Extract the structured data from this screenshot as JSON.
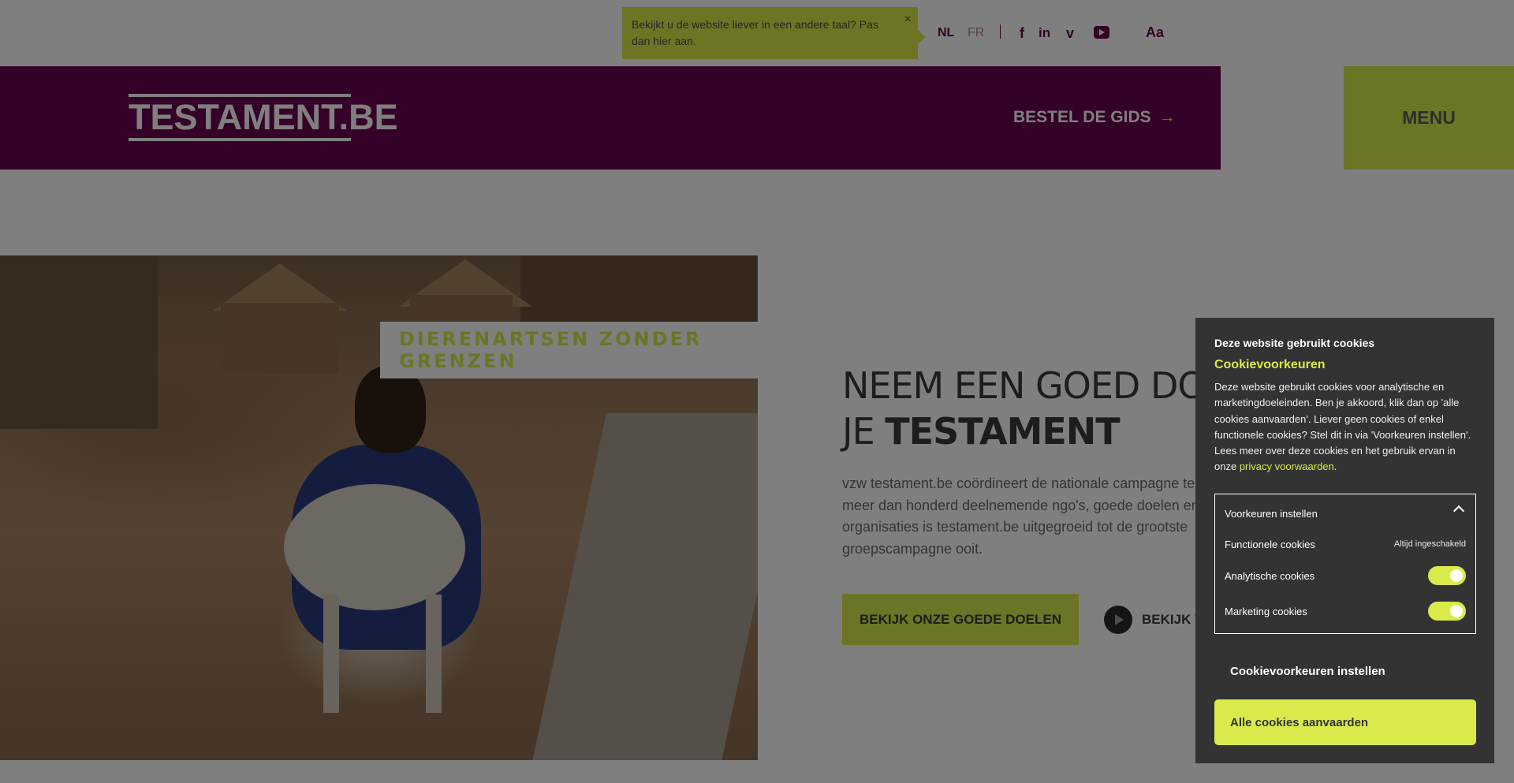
{
  "topbar": {
    "language_notice": "Bekijkt u de website liever in een andere taal? Pas dan hier aan.",
    "close_glyph": "×",
    "languages": [
      {
        "code": "NL",
        "active": true
      },
      {
        "code": "FR",
        "active": false
      }
    ],
    "social": [
      "facebook-icon",
      "linkedin-icon",
      "vimeo-icon",
      "youtube-icon"
    ],
    "social_glyphs": {
      "facebook": "f",
      "linkedin": "in",
      "vimeo": "v"
    },
    "font_size_label": "Aa"
  },
  "header": {
    "logo_text": "TESTAMENT.BE",
    "order_guide_label": "BESTEL DE GIDS",
    "order_guide_arrow": "→",
    "menu_label": "MENU",
    "brand_color": "#6b0050",
    "accent_color": "#d9ea4a"
  },
  "hero": {
    "photo_tag": "DIERENARTSEN ZONDER GRENZEN",
    "title_light_1": "NEEM EEN GOED DOEL O",
    "title_light_2": "JE ",
    "title_bold": "TESTAMENT",
    "text_lines": [
      "vzw testament.be coördineert de nationale campagne te",
      "meer dan honderd deelnemende ngo's, goede doelen en",
      "organisaties is testament.be uitgegroeid tot de grootste",
      "groepscampagne ooit."
    ],
    "cta_primary": "BEKIJK ONZE GOEDE DOELEN",
    "cta_video": "BEKIJK V"
  },
  "cookie": {
    "title": "Deze website gebruikt cookies",
    "subtitle": "Cookievoorkeuren",
    "body": "Deze website gebruikt cookies voor analytische en marketingdoeleinden. Ben je akkoord, klik dan op 'alle cookies aanvaarden'. Liever geen cookies of enkel functionele cookies? Stel dit in via 'Voorkeuren instellen'. Lees meer over deze cookies en het gebruik ervan in onze ",
    "privacy_link": "privacy voorwaarden",
    "body_end": ".",
    "prefs_header": "Voorkeuren instellen",
    "functional_label": "Functionele cookies",
    "functional_status": "Altijd ingeschakeld",
    "analytics_label": "Analytische cookies",
    "analytics_enabled": true,
    "marketing_label": "Marketing cookies",
    "marketing_enabled": true,
    "set_prefs_button": "Cookievoorkeuren instellen",
    "accept_all_button": "Alle cookies aanvaarden"
  }
}
